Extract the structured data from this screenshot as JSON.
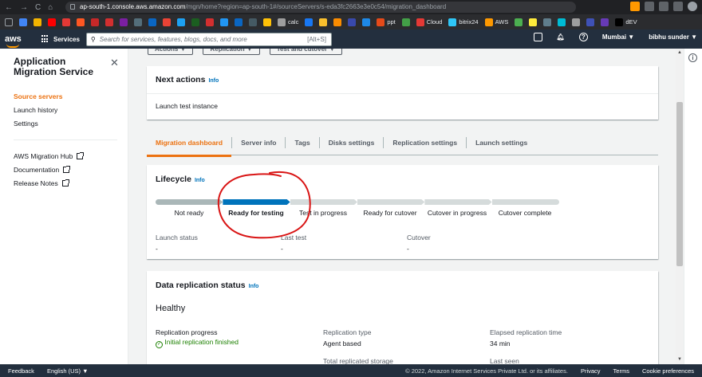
{
  "browser": {
    "url_host": "ap-south-1.console.aws.amazon.com",
    "url_path": "/mgn/home?region=ap-south-1#/sourceServers/s-eda3fc2663e3e0c54/migration_dashboard",
    "bookmarks": [
      {
        "label": "",
        "color": "#4285f4"
      },
      {
        "label": "",
        "color": "#f4b400"
      },
      {
        "label": "",
        "color": "#ff0000"
      },
      {
        "label": "",
        "color": "#e53935"
      },
      {
        "label": "",
        "color": "#ff5722"
      },
      {
        "label": "",
        "color": "#c62828"
      },
      {
        "label": "",
        "color": "#d32f2f"
      },
      {
        "label": "",
        "color": "#7b1fa2"
      },
      {
        "label": "",
        "color": "#546e7a"
      },
      {
        "label": "",
        "color": "#0a66c2"
      },
      {
        "label": "",
        "color": "#ea4335"
      },
      {
        "label": "",
        "color": "#1da1f2"
      },
      {
        "label": "",
        "color": "#1b5e20"
      },
      {
        "label": "",
        "color": "#d32f2f"
      },
      {
        "label": "",
        "color": "#2196f3"
      },
      {
        "label": "",
        "color": "#0a66c2"
      },
      {
        "label": "",
        "color": "#455a64"
      },
      {
        "label": "",
        "color": "#ffc107"
      },
      {
        "label": "calc",
        "color": "#9e9e9e"
      },
      {
        "label": "",
        "color": "#1877f2"
      },
      {
        "label": "",
        "color": "#fbc02d"
      },
      {
        "label": "",
        "color": "#fb8c00"
      },
      {
        "label": "",
        "color": "#3949ab"
      },
      {
        "label": "",
        "color": "#1e88e5"
      },
      {
        "label": "ppt",
        "color": "#e64a19"
      },
      {
        "label": "",
        "color": "#43a047"
      },
      {
        "label": "Cloud",
        "color": "#e53935"
      },
      {
        "label": "bitrix24",
        "color": "#2fc6f6"
      },
      {
        "label": "AWS",
        "color": "#ff9900"
      },
      {
        "label": "",
        "color": "#4caf50"
      },
      {
        "label": "",
        "color": "#ffeb3b"
      },
      {
        "label": "",
        "color": "#607d8b"
      },
      {
        "label": "",
        "color": "#00bcd4"
      },
      {
        "label": "",
        "color": "#9e9e9e"
      },
      {
        "label": "",
        "color": "#3f51b5"
      },
      {
        "label": "",
        "color": "#673ab7"
      },
      {
        "label": "dEV",
        "color": "#000000"
      }
    ]
  },
  "aws_header": {
    "logo": "aws",
    "services": "Services",
    "search_placeholder": "Search for services, features, blogs, docs, and more",
    "search_shortcut": "[Alt+S]",
    "region": "Mumbai ▼",
    "account": "bibhu sunder ▼"
  },
  "sidebar": {
    "title": "Application Migration Service",
    "items": [
      {
        "label": "Source servers",
        "active": true
      },
      {
        "label": "Launch history"
      },
      {
        "label": "Settings"
      }
    ],
    "external": [
      {
        "label": "AWS Migration Hub"
      },
      {
        "label": "Documentation"
      },
      {
        "label": "Release Notes"
      }
    ]
  },
  "top_actions": [
    "Actions ▼",
    "Replication ▼",
    "Test and cutover ▼"
  ],
  "next_actions": {
    "title": "Next actions",
    "info": "Info",
    "body": "Launch test instance"
  },
  "tabs": [
    {
      "label": "Migration dashboard",
      "active": true
    },
    {
      "label": "Server info"
    },
    {
      "label": "Tags"
    },
    {
      "label": "Disks settings"
    },
    {
      "label": "Replication settings"
    },
    {
      "label": "Launch settings"
    }
  ],
  "lifecycle": {
    "title": "Lifecycle",
    "info": "Info",
    "stages": [
      "Not ready",
      "Ready for testing",
      "Test in progress",
      "Ready for cutover",
      "Cutover in progress",
      "Cutover complete"
    ],
    "current_stage": "Ready for testing",
    "fields": [
      {
        "label": "Launch status",
        "value": "-"
      },
      {
        "label": "Last test",
        "value": "-"
      },
      {
        "label": "Cutover",
        "value": "-"
      }
    ]
  },
  "data_replication": {
    "title": "Data replication status",
    "info": "Info",
    "state": "Healthy",
    "fields": [
      {
        "label": "Replication progress",
        "value": "Initial replication finished"
      },
      {
        "label": "Replication type",
        "value": "Agent based"
      },
      {
        "label": "Elapsed replication time",
        "value": "34 min"
      },
      {
        "label": "Total replicated storage",
        "value": ""
      },
      {
        "label": "Last seen",
        "value": ""
      }
    ]
  },
  "footer": {
    "feedback": "Feedback",
    "language": "English (US) ▼",
    "copyright": "© 2022, Amazon Internet Services Private Ltd. or its affiliates.",
    "privacy": "Privacy",
    "terms": "Terms",
    "cookies": "Cookie preferences"
  },
  "colors": {
    "accent": "#ec7211",
    "progress_done": "#aab7b8",
    "progress_current": "#0073bb",
    "progress_todo": "#d5dbdb",
    "success": "#1d8102",
    "annotation": "#d91515"
  }
}
